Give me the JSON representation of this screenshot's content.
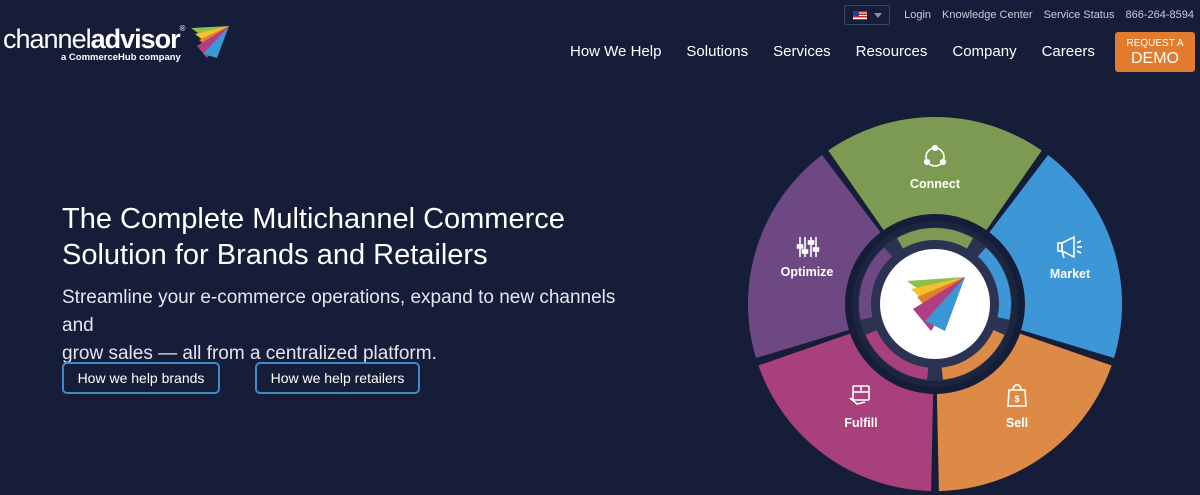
{
  "utility": {
    "links": [
      "Login",
      "Knowledge Center",
      "Service Status"
    ],
    "phone": "866-264-8594"
  },
  "logo": {
    "word_light": "channel",
    "word_bold": "advisor",
    "reg": "®",
    "tagline": "a CommerceHub company"
  },
  "nav": {
    "items": [
      "How We Help",
      "Solutions",
      "Services",
      "Resources",
      "Company",
      "Careers"
    ],
    "demo_top": "REQUEST A",
    "demo_bottom": "DEMO"
  },
  "hero": {
    "title_line1": "The Complete Multichannel Commerce",
    "title_line2": "Solution for Brands and Retailers",
    "subtitle_line1": "Streamline your e-commerce operations, expand to new channels and",
    "subtitle_line2": "grow sales — all from a centralized platform.",
    "button_brands": "How we help brands",
    "button_retailers": "How we help retailers"
  },
  "wheel": {
    "segments": [
      {
        "label": "Connect",
        "icon": "connect-icon",
        "color": "#7d9a53"
      },
      {
        "label": "Market",
        "icon": "megaphone-icon",
        "color": "#3d97d6"
      },
      {
        "label": "Sell",
        "icon": "shopping-bag-icon",
        "color": "#de8a47"
      },
      {
        "label": "Fulfill",
        "icon": "package-icon",
        "color": "#a8407c"
      },
      {
        "label": "Optimize",
        "icon": "sliders-icon",
        "color": "#6e4882"
      }
    ]
  },
  "colors": {
    "background": "#161d38",
    "accent_orange": "#e17b2d",
    "button_border": "#3f8bc7"
  }
}
